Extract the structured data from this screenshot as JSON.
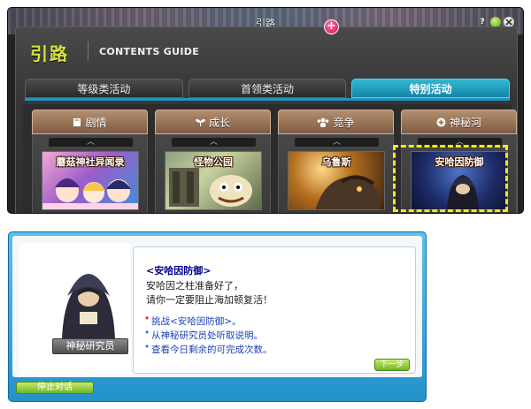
{
  "window": {
    "title": "引路",
    "help_icon": "?",
    "min_icon": "minimize-icon",
    "close_icon": "close-icon"
  },
  "guide": {
    "title_cn": "引路",
    "title_en": "CONTENTS GUIDE"
  },
  "tabs": [
    {
      "label": "等级类活动",
      "active": false
    },
    {
      "label": "首领类活动",
      "active": false
    },
    {
      "label": "特别活动",
      "active": true
    }
  ],
  "tab_badge": "+",
  "cards": [
    {
      "label": "剧情",
      "icon": "book-icon",
      "arrow": "︿",
      "thumb_title": "蘑菇神社异闻录"
    },
    {
      "label": "成长",
      "icon": "sprout-icon",
      "arrow": "︿",
      "thumb_title": "怪物公园"
    },
    {
      "label": "竞争",
      "icon": "group-icon",
      "arrow": "︿",
      "thumb_title": "乌鲁斯"
    },
    {
      "label": "神秘河",
      "icon": "plus-circle-icon",
      "arrow": "︿",
      "thumb_title": "安哈因防御"
    }
  ],
  "dialog": {
    "npc_name": "神秘研究员",
    "quest_title": "<安哈因防御>",
    "lines": [
      "安哈因之柱准备好了，",
      "请你一定要阻止海加顿复活！"
    ],
    "options": [
      "挑战<安哈因防御>。",
      "从神秘研究员处听取说明。",
      "查看今日剩余的可完成次数。"
    ],
    "next_label": "下一步",
    "end_label": "停止对话"
  },
  "colors": {
    "accent_title": "#d7e23a",
    "active_tab": "#1d97bc",
    "selection_frame": "#f6ea12",
    "dialog_frame": "#2392cb",
    "button_green": "#6fb32a"
  }
}
